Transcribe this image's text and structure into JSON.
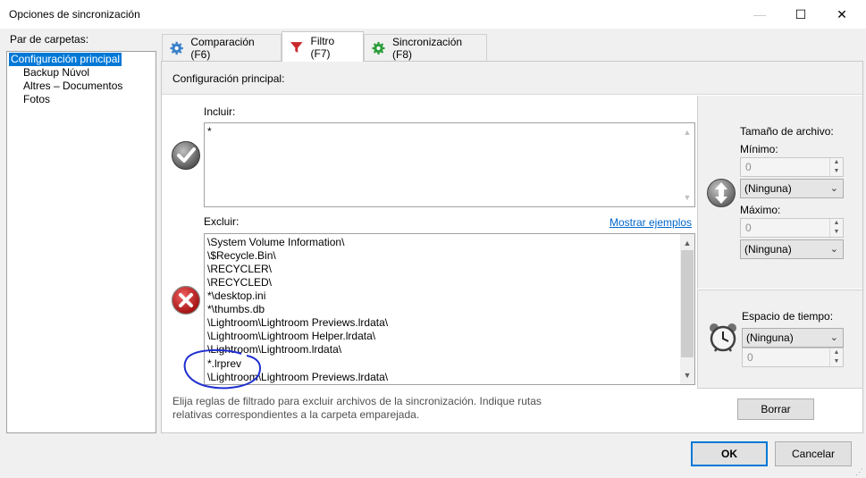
{
  "window": {
    "title": "Opciones de sincronización",
    "min": "—",
    "max": "☐",
    "close": "✕"
  },
  "left": {
    "heading": "Par de carpetas:",
    "items": [
      "Configuración principal",
      "Backup Núvol",
      "Altres – Documentos",
      "Fotos"
    ]
  },
  "tabs": [
    {
      "label": "Comparación (F6)",
      "icon": "gear-icon-blue"
    },
    {
      "label": "Filtro (F7)",
      "icon": "funnel-icon"
    },
    {
      "label": "Sincronización (F8)",
      "icon": "gear-icon-green"
    }
  ],
  "filter": {
    "section_title": "Configuración principal:",
    "include_label": "Incluir:",
    "include_text": "*",
    "exclude_label": "Excluir:",
    "show_examples": "Mostrar ejemplos",
    "exclude_lines": [
      "\\System Volume Information\\",
      "\\$Recycle.Bin\\",
      "\\RECYCLER\\",
      "\\RECYCLED\\",
      "*\\desktop.ini",
      "*\\thumbs.db",
      "\\Lightroom\\Lightroom Previews.lrdata\\",
      "\\Lightroom\\Lightroom Helper.lrdata\\",
      "\\Lightroom\\Lightroom.lrdata\\",
      "*.lrprev",
      "\\Lightroom\\Lightroom Previews.lrdata\\"
    ],
    "help_line1": "Elija reglas de filtrado para excluir archivos de la sincronización. Indique rutas",
    "help_line2": "relativas correspondientes a la carpeta emparejada."
  },
  "size": {
    "title": "Tamaño de archivo:",
    "min_label": "Mínimo:",
    "min_value": "0",
    "min_unit": "(Ninguna)",
    "max_label": "Máximo:",
    "max_value": "0",
    "max_unit": "(Ninguna)"
  },
  "time": {
    "title": "Espacio de tiempo:",
    "unit": "(Ninguna)",
    "value": "0"
  },
  "buttons": {
    "clear": "Borrar",
    "ok": "OK",
    "cancel": "Cancelar"
  },
  "colors": {
    "accent": "#0078d7",
    "link": "#0066cc",
    "annotation": "#1f2fd0"
  }
}
